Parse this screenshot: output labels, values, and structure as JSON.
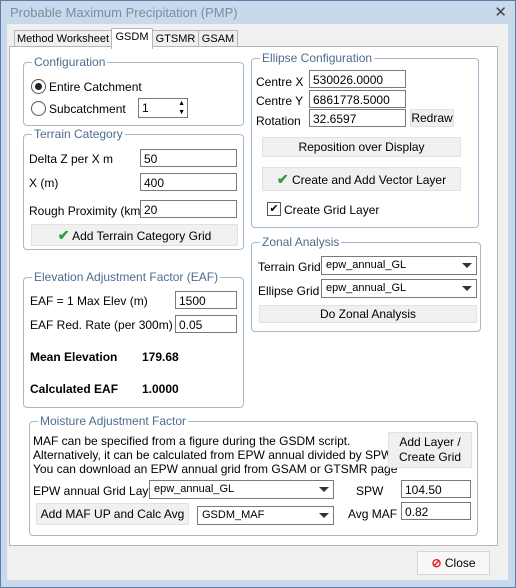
{
  "window": {
    "title": "Probable Maximum Precipitation (PMP)"
  },
  "tabs": [
    "Method Worksheet",
    "GSDM",
    "GTSMR",
    "GSAM"
  ],
  "configuration": {
    "label": "Configuration",
    "entire": "Entire Catchment",
    "sub": "Subcatchment",
    "sub_value": "1"
  },
  "terrain": {
    "label": "Terrain Category",
    "dz_label": "Delta Z per X m",
    "dz": "50",
    "x_label": "X (m)",
    "x": "400",
    "rough_label": "Rough Proximity (km)",
    "rough": "20",
    "add_button": "Add Terrain Category Grid"
  },
  "eaf": {
    "label": "Elevation Adjustment Factor (EAF)",
    "max_label": "EAF = 1 Max Elev (m)",
    "max": "1500",
    "red_label": "EAF Red. Rate (per 300m)",
    "red": "0.05",
    "mean_label": "Mean Elevation",
    "mean": "179.68",
    "calc_label": "Calculated EAF",
    "calc": "1.0000"
  },
  "ellipse": {
    "label": "Ellipse Configuration",
    "cx_label": "Centre X",
    "cx": "530026.0000",
    "cy_label": "Centre Y",
    "cy": "6861778.5000",
    "rot_label": "Rotation",
    "rot": "32.6597",
    "redraw": "Redraw",
    "reposition": "Reposition over Display",
    "create_vector": "Create and Add Vector Layer",
    "create_grid": "Create Grid Layer"
  },
  "zonal": {
    "label": "Zonal Analysis",
    "terrain_label": "Terrain Grid",
    "terrain_value": "epw_annual_GL",
    "ellipse_label": "Ellipse Grid",
    "ellipse_value": "epw_annual_GL",
    "do": "Do Zonal Analysis"
  },
  "maf": {
    "label": "Moisture Adjustment Factor",
    "line1": "MAF can be specified from a figure during the GSDM script.",
    "line2": "Alternatively, it can be calculated from EPW annual divided by SPW",
    "line3": "You can download an EPW annual grid from GSAM or GTSMR page",
    "add_layer": "Add Layer /",
    "add_layer2": "Create Grid",
    "epw_label": "EPW annual Grid Layer",
    "epw_value": "epw_annual_GL",
    "spw_label": "SPW",
    "spw": "104.50",
    "add_maf": "Add MAF UP and Calc Avg",
    "maf_combo": "GSDM_MAF",
    "avg_label": "Avg MAF",
    "avg": "0.82"
  },
  "footer": {
    "close": "Close"
  }
}
